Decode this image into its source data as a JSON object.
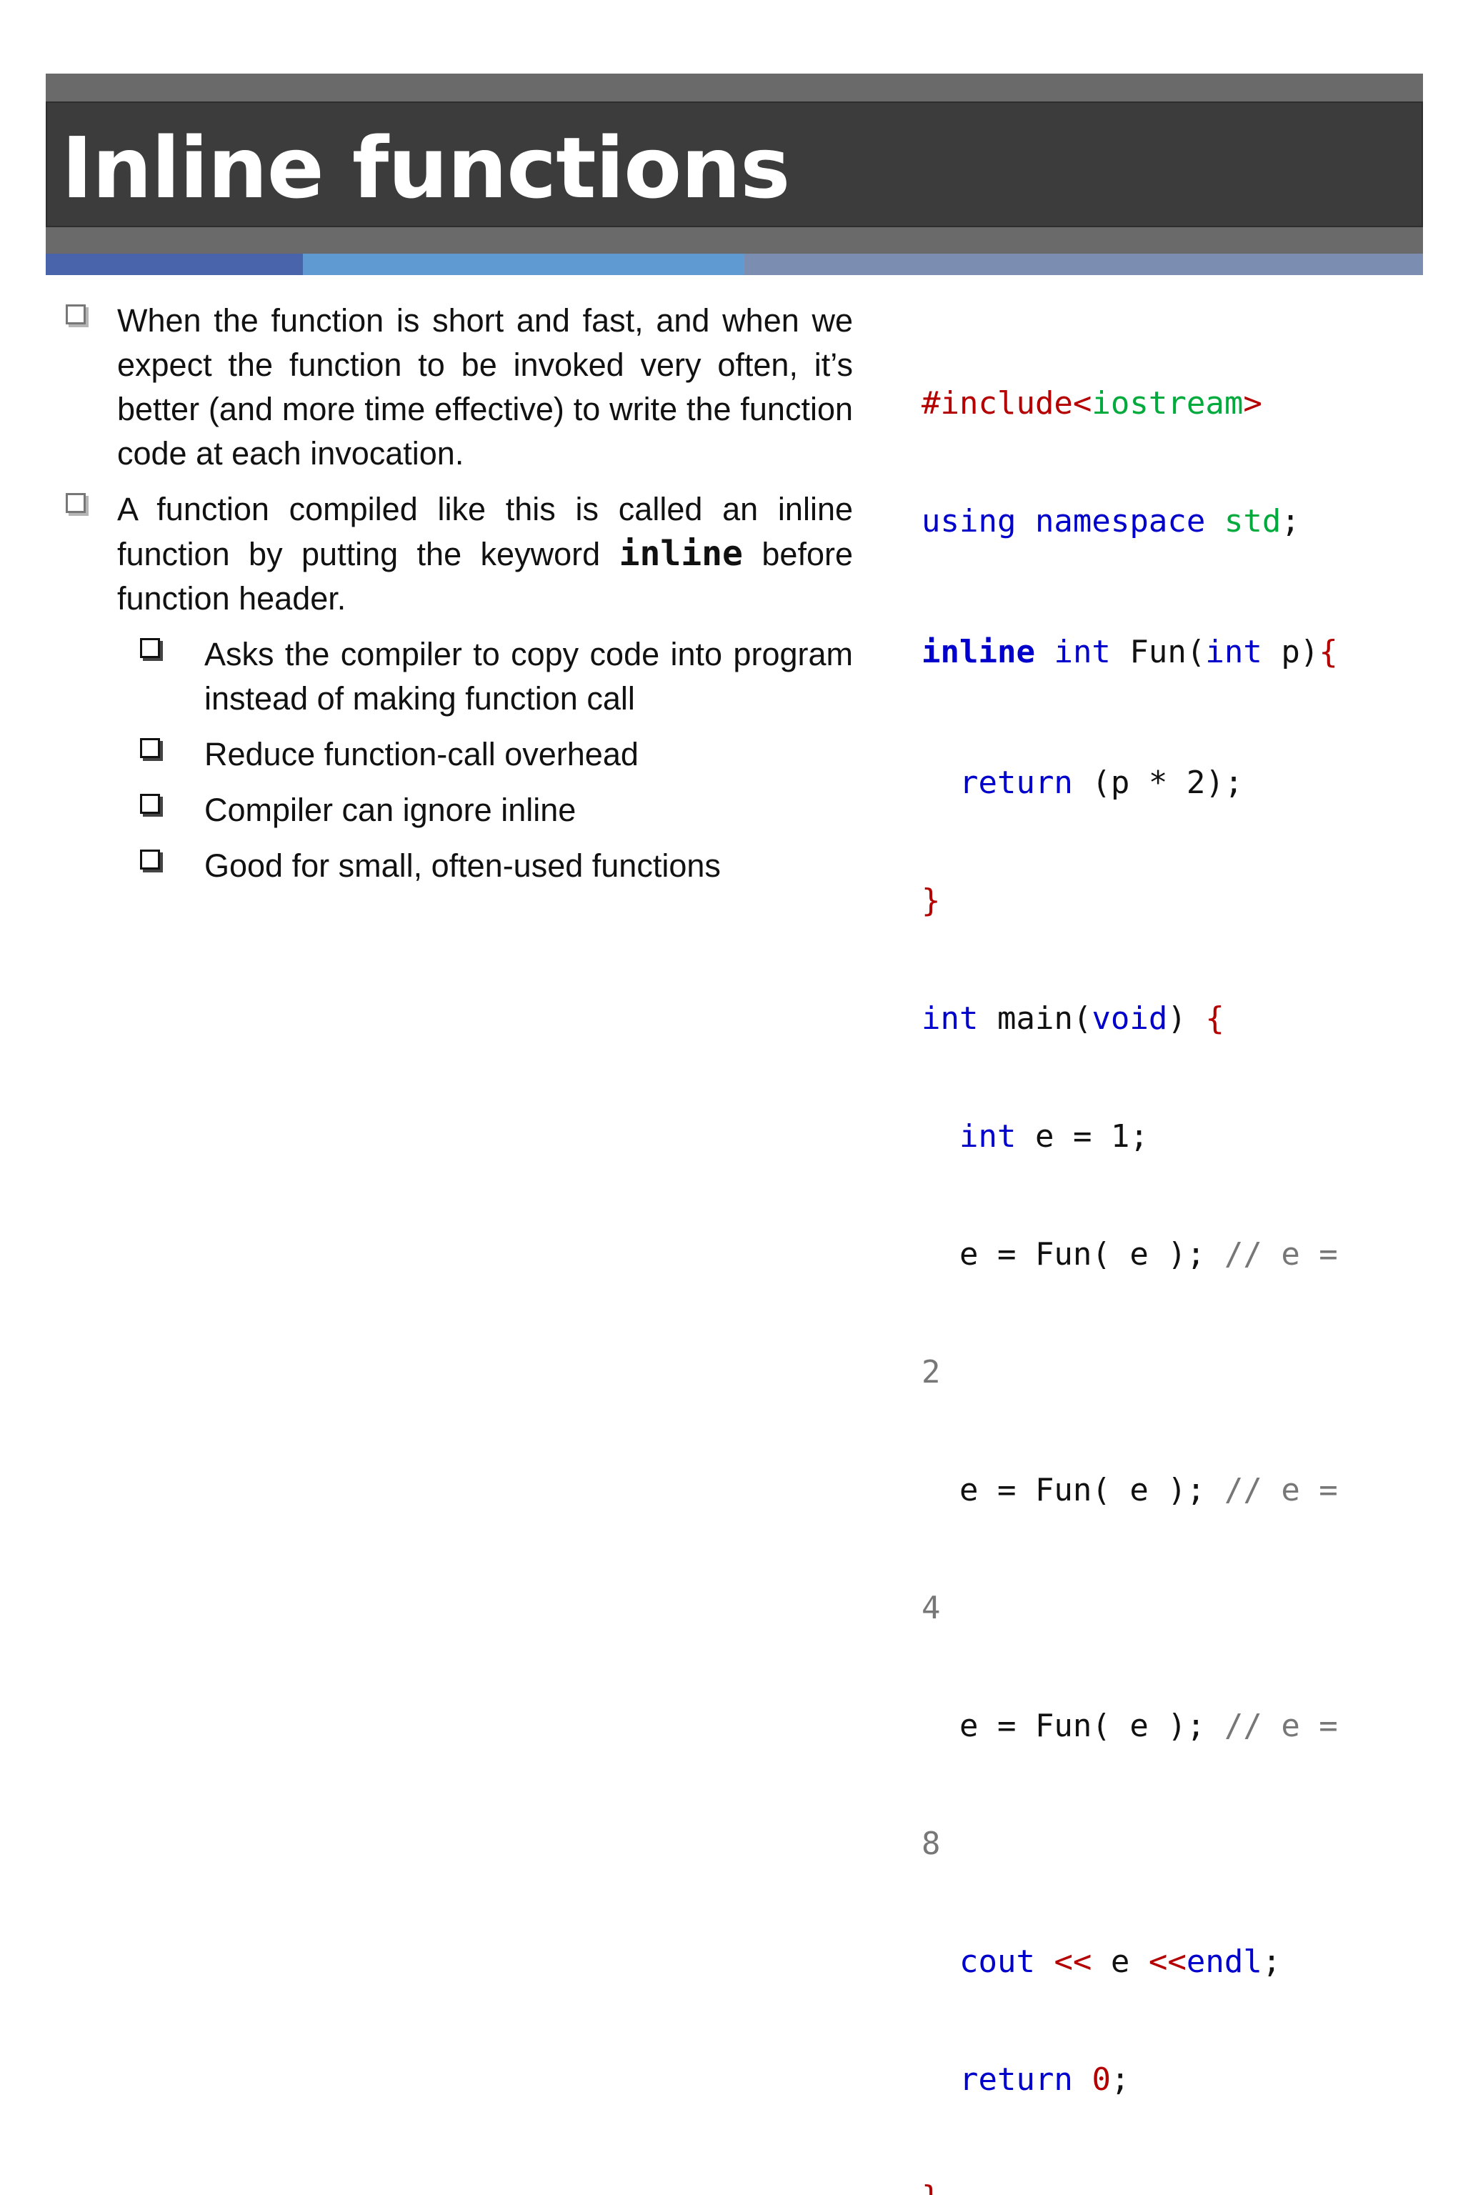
{
  "slide": {
    "title": "Inline functions",
    "bullets": [
      "When the function is short and fast, and when we expect the function to be invoked very often, it’s better (and more time effective) to write the function code at each invocation.",
      {
        "before": "A function compiled like this is called an inline function by putting the keyword ",
        "keyword": "inline",
        "after": " before function header."
      }
    ],
    "sub_bullets": [
      "Asks the compiler to copy code into program instead of making function call",
      "Reduce function-call overhead",
      "Compiler can ignore inline",
      "Good for small, often-used functions"
    ]
  },
  "code": {
    "line1": {
      "directive": "#include",
      "lt": "<",
      "header": "iostream",
      "gt": ">"
    },
    "line2": {
      "kw": "using namespace",
      "sp": " ",
      "ns": "std",
      "semi": ";"
    },
    "line3": {
      "kw_inline": "inline",
      "kw_int": "int",
      "name": " Fun(",
      "param_type": "int",
      "param": " p)",
      "brace": "{"
    },
    "line4": {
      "indent": "  ",
      "kw": "return",
      "expr": " (p * 2);"
    },
    "line5": {
      "brace": "}"
    },
    "line6": {
      "kw_int": "int",
      "name": " main(",
      "kw_void": "void",
      "close": ") ",
      "brace": "{"
    },
    "line7": {
      "indent": "  ",
      "kw_int": "int",
      "rest": " e = 1;"
    },
    "calls": [
      {
        "stmt": "  e = Fun( e ); ",
        "comment": "// e =",
        "wrap": "2"
      },
      {
        "stmt": "  e = Fun( e ); ",
        "comment": "// e =",
        "wrap": "4"
      },
      {
        "stmt": "  e = Fun( e ); ",
        "comment": "// e =",
        "wrap": "8"
      }
    ],
    "line_cout": {
      "indent": "  ",
      "kw": "cout",
      "op1": " << ",
      "var": "e",
      "op2": " <<",
      "endl": "endl",
      "semi": ";"
    },
    "line_return": {
      "indent": "  ",
      "kw": "return",
      "sp": " ",
      "num": "0",
      "semi": ";"
    },
    "line_end": {
      "brace": "}"
    }
  }
}
